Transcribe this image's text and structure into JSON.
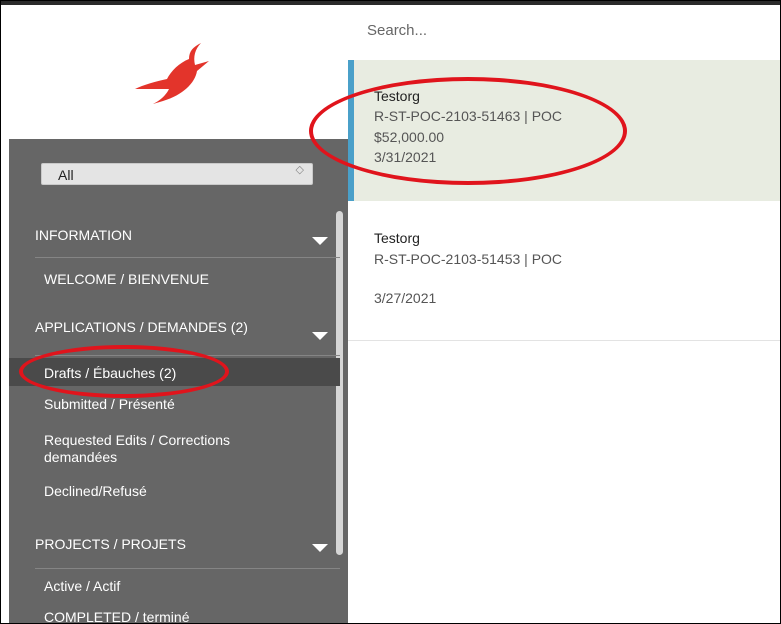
{
  "search": {
    "placeholder": "Search..."
  },
  "filter": {
    "value": "All"
  },
  "nav": {
    "information": {
      "label": "INFORMATION",
      "items": [
        "WELCOME / BIENVENUE"
      ]
    },
    "applications": {
      "label": "APPLICATIONS / DEMANDES (2)",
      "items": [
        "Drafts / Ébauches  (2)",
        "Submitted / Présenté",
        "Requested Edits / Corrections demandées",
        "Declined/Refusé"
      ]
    },
    "projects": {
      "label": "PROJECTS / PROJETS",
      "items": [
        "Active / Actif",
        "COMPLETED / terminé"
      ]
    }
  },
  "results": [
    {
      "title": "Testorg",
      "reference": "R-ST-POC-2103-51463 | POC",
      "amount": "$52,000.00",
      "date": "3/31/2021"
    },
    {
      "title": "Testorg",
      "reference": "R-ST-POC-2103-51453 | POC",
      "amount": "",
      "date": "3/27/2021"
    }
  ],
  "colors": {
    "sidebar": "#666666",
    "accent": "#4aa0c9",
    "highlight": "#e0141c",
    "logo": "#e3342b"
  }
}
